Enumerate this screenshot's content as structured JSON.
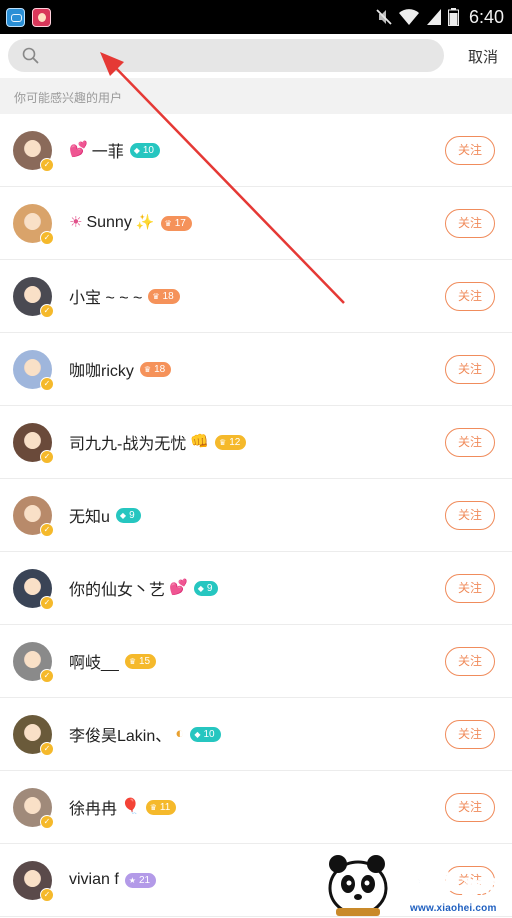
{
  "status_bar": {
    "time": "6:40",
    "icons": [
      "app-icon-1",
      "app-icon-2",
      "mute-icon",
      "wifi-icon",
      "signal-icon",
      "battery-icon"
    ]
  },
  "search": {
    "value": "",
    "placeholder": "",
    "cancel_label": "取消"
  },
  "section": {
    "title": "你可能感兴趣的用户"
  },
  "colors": {
    "accent_orange": "#f08c5c",
    "level_teal": "#26c6c0",
    "level_orange": "#f5925a",
    "level_yellow": "#f5b92b",
    "level_purple": "#b39ae8",
    "verified_badge": "#f5b92b",
    "annotation_arrow": "#e53935"
  },
  "users": [
    {
      "name": "一菲",
      "prefix_emoji": "💕",
      "suffix_emoji": "",
      "level": "10",
      "level_icon": "diamond-icon",
      "level_color": "#26c6c0",
      "avatar_color": "#8a6a5a",
      "follow_label": "关注"
    },
    {
      "name": "Sunny",
      "prefix_emoji": "☀",
      "suffix_emoji": "✨",
      "level": "17",
      "level_icon": "crown-icon",
      "level_color": "#f5925a",
      "avatar_color": "#d9a36a",
      "follow_label": "关注"
    },
    {
      "name": "小宝 ~ ~ ~",
      "prefix_emoji": "",
      "suffix_emoji": "",
      "level": "18",
      "level_icon": "crown-icon",
      "level_color": "#f5925a",
      "avatar_color": "#4a4a52",
      "follow_label": "关注"
    },
    {
      "name": "咖咖ricky",
      "prefix_emoji": "",
      "suffix_emoji": "",
      "level": "18",
      "level_icon": "crown-icon",
      "level_color": "#f5925a",
      "avatar_color": "#9fb6dc",
      "follow_label": "关注"
    },
    {
      "name": "司九九-战为无忧",
      "prefix_emoji": "",
      "suffix_emoji": "👊",
      "level": "12",
      "level_icon": "crown-icon",
      "level_color": "#f5b92b",
      "avatar_color": "#6a4a3a",
      "follow_label": "关注"
    },
    {
      "name": "无知u",
      "prefix_emoji": "",
      "suffix_emoji": "",
      "level": "9",
      "level_icon": "diamond-icon",
      "level_color": "#26c6c0",
      "avatar_color": "#b88a6a",
      "follow_label": "关注"
    },
    {
      "name": "你的仙女丶艺",
      "prefix_emoji": "",
      "suffix_emoji": "💕",
      "level": "9",
      "level_icon": "diamond-icon",
      "level_color": "#26c6c0",
      "avatar_color": "#3a4456",
      "follow_label": "关注"
    },
    {
      "name": "啊岐__",
      "prefix_emoji": "",
      "suffix_emoji": "",
      "level": "15",
      "level_icon": "crown-icon",
      "level_color": "#f5b92b",
      "avatar_color": "#8a8a8a",
      "follow_label": "关注"
    },
    {
      "name": "李俊昊Lakin、",
      "prefix_emoji": "",
      "suffix_emoji": "◐",
      "level": "10",
      "level_icon": "diamond-icon",
      "level_color": "#26c6c0",
      "avatar_color": "#6a5a3a",
      "follow_label": "关注"
    },
    {
      "name": "徐冉冉",
      "prefix_emoji": "",
      "suffix_emoji": "🎈",
      "level": "11",
      "level_icon": "crown-icon",
      "level_color": "#f5b92b",
      "avatar_color": "#a08a7a",
      "follow_label": "关注"
    },
    {
      "name": "vivian f",
      "prefix_emoji": "",
      "suffix_emoji": "",
      "level": "21",
      "level_icon": "star-icon",
      "level_color": "#b39ae8",
      "avatar_color": "#5a4a4a",
      "follow_label": "关注"
    }
  ],
  "watermark": {
    "url_text": "www.xiaohei.com"
  }
}
